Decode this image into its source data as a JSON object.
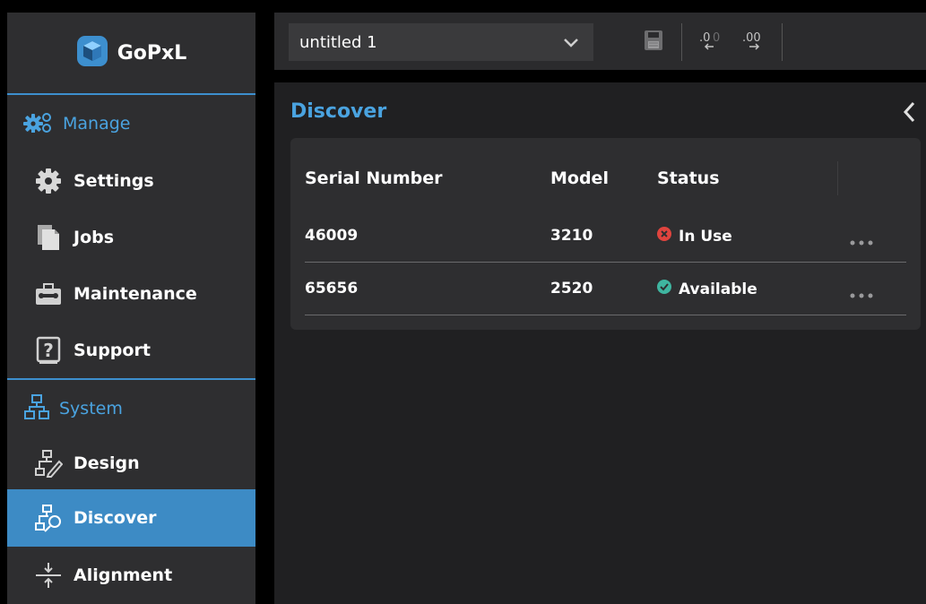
{
  "app": {
    "name": "GoPxL"
  },
  "sidebar": {
    "sections": [
      {
        "title": "Manage",
        "items": [
          {
            "label": "Settings",
            "icon": "gear-icon"
          },
          {
            "label": "Jobs",
            "icon": "document-icon"
          },
          {
            "label": "Maintenance",
            "icon": "toolbox-icon"
          },
          {
            "label": "Support",
            "icon": "help-icon"
          }
        ]
      },
      {
        "title": "System",
        "items": [
          {
            "label": "Design",
            "icon": "design-network-icon"
          },
          {
            "label": "Discover",
            "icon": "discover-network-icon",
            "selected": true
          },
          {
            "label": "Alignment",
            "icon": "alignment-icon"
          }
        ]
      }
    ]
  },
  "toolbar": {
    "job_name": "untitled 1",
    "icons": [
      "chevron-down-icon",
      "save-icon",
      "decrease-decimal-icon",
      "increase-decimal-icon"
    ]
  },
  "panel": {
    "title": "Discover",
    "table": {
      "columns": [
        "Serial Number",
        "Model",
        "Status"
      ],
      "rows": [
        {
          "serial": "46009",
          "model": "3210",
          "status": "In Use",
          "status_kind": "error"
        },
        {
          "serial": "65656",
          "model": "2520",
          "status": "Available",
          "status_kind": "ok"
        }
      ]
    }
  },
  "colors": {
    "accent": "#4aa3e0",
    "selected": "#3d8bc5",
    "status_error": "#e0443e",
    "status_ok": "#3fb5a0"
  }
}
